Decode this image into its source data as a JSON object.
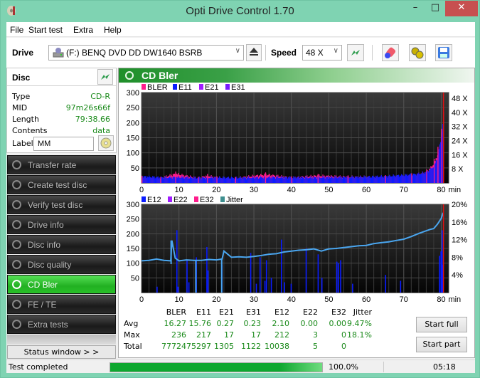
{
  "window": {
    "title": "Opti Drive Control 1.70",
    "min": "–",
    "max": "□",
    "close": "✕"
  },
  "menu": [
    "File",
    "Start test",
    "Extra",
    "Help"
  ],
  "toolbar": {
    "drive_label": "Drive",
    "drive_value": "(F:)   BENQ DVD DD DW1640 BSRB",
    "speed_label": "Speed",
    "speed_value": "48 X",
    "icons": [
      "eject-icon",
      "refresh-icon",
      "erase-icon",
      "settings-icon",
      "save-icon"
    ]
  },
  "disc": {
    "title": "Disc",
    "rows": [
      {
        "key": "Type",
        "value": "CD-R"
      },
      {
        "key": "MID",
        "value": "97m26s66f"
      },
      {
        "key": "Length",
        "value": "79:38.66"
      },
      {
        "key": "Contents",
        "value": "data"
      }
    ],
    "label_key": "Label",
    "label_value": "MM"
  },
  "nav": [
    {
      "label": "Transfer rate",
      "active": false
    },
    {
      "label": "Create test disc",
      "active": false
    },
    {
      "label": "Verify test disc",
      "active": false
    },
    {
      "label": "Drive info",
      "active": false
    },
    {
      "label": "Disc info",
      "active": false
    },
    {
      "label": "Disc quality",
      "active": false
    },
    {
      "label": "CD Bler",
      "active": true
    },
    {
      "label": "FE / TE",
      "active": false
    },
    {
      "label": "Extra tests",
      "active": false
    }
  ],
  "status_window_button": "Status window > >",
  "panel_title": "CD Bler",
  "chart_data": [
    {
      "type": "bar",
      "title": "BLER / E11 / E21 / E31",
      "legend": [
        {
          "name": "BLER",
          "color": "#ff1c8c"
        },
        {
          "name": "E11",
          "color": "#0a1cff"
        },
        {
          "name": "E21",
          "color": "#a01cff"
        },
        {
          "name": "E31",
          "color": "#7a1cff"
        }
      ],
      "xlabel": "min",
      "x_ticks": [
        0,
        10,
        20,
        30,
        40,
        50,
        60,
        70,
        80
      ],
      "xlim": [
        0,
        82
      ],
      "y_ticks": [
        50,
        100,
        150,
        200,
        250,
        300
      ],
      "ylim": [
        0,
        300
      ],
      "y2_ticks": [
        "8 X",
        "16 X",
        "24 X",
        "32 X",
        "40 X",
        "48 X"
      ],
      "series": [
        {
          "name": "E11",
          "x": [
            0,
            5,
            10,
            15,
            20,
            25,
            30,
            35,
            40,
            45,
            50,
            55,
            60,
            65,
            70,
            74,
            76,
            78,
            79,
            80,
            80.5
          ],
          "values": [
            22,
            18,
            19,
            17,
            18,
            17,
            18,
            19,
            18,
            18,
            19,
            19,
            20,
            22,
            26,
            30,
            36,
            55,
            90,
            160,
            215
          ]
        },
        {
          "name": "BLER",
          "x": [
            0,
            5,
            9,
            15,
            17.5,
            20,
            25,
            33,
            40,
            47,
            55,
            65,
            72,
            76,
            78,
            79,
            80,
            80.5
          ],
          "values": [
            24,
            20,
            38,
            20,
            30,
            22,
            20,
            35,
            22,
            30,
            25,
            26,
            32,
            45,
            80,
            120,
            180,
            236
          ]
        }
      ],
      "end_marker_x": 80.6
    },
    {
      "type": "bar",
      "title": "E12 / E22 / E32 / Jitter",
      "legend": [
        {
          "name": "E12",
          "color": "#0a1cff"
        },
        {
          "name": "E22",
          "color": "#a01cff"
        },
        {
          "name": "E32",
          "color": "#ff1c8c"
        },
        {
          "name": "Jitter",
          "color": "#3f8f8f"
        }
      ],
      "xlabel": "min",
      "x_ticks": [
        0,
        10,
        20,
        30,
        40,
        50,
        60,
        70,
        80
      ],
      "xlim": [
        0,
        82
      ],
      "y_ticks": [
        50,
        100,
        150,
        200,
        250,
        300
      ],
      "ylim": [
        0,
        300
      ],
      "y2_ticks": [
        "4%",
        "8%",
        "12%",
        "16%",
        "20%"
      ],
      "y2lim": [
        0,
        20
      ],
      "series": [
        {
          "name": "E12",
          "x": [
            4,
            9.3,
            9.6,
            12,
            12.5,
            14.5,
            17.3,
            17.6,
            21.3,
            29,
            30.5,
            31.5,
            32.8,
            33.2,
            34.5,
            37.2,
            38,
            39.8,
            43.8,
            47,
            48,
            52,
            52.4,
            53,
            56.2,
            65,
            69,
            79.4,
            79.8,
            80.1,
            80.3
          ],
          "values": [
            20,
            212,
            20,
            110,
            35,
            120,
            155,
            75,
            95,
            135,
            30,
            120,
            40,
            110,
            50,
            180,
            35,
            30,
            150,
            130,
            50,
            105,
            100,
            110,
            30,
            60,
            40,
            125,
            140,
            212,
            95
          ]
        },
        {
          "name": "Jitter",
          "x": [
            0,
            2,
            4,
            6,
            7.8,
            8.1,
            9,
            10,
            12,
            14,
            16,
            18,
            20,
            21.5,
            22,
            24,
            26,
            28,
            30,
            32,
            34,
            36,
            38,
            40,
            42,
            44,
            46,
            48,
            50,
            52,
            54,
            56,
            58,
            60,
            62,
            64,
            66,
            68,
            70,
            72,
            74,
            76,
            77,
            78,
            79,
            80,
            80.5
          ],
          "values": [
            7.2,
            7.3,
            7.6,
            7.3,
            7.2,
            11.8,
            7.8,
            7.2,
            7.4,
            7.3,
            7.3,
            7.5,
            7.4,
            7.6,
            9.4,
            8.0,
            8.1,
            8.0,
            8.2,
            8.4,
            8.7,
            8.8,
            9.2,
            9.4,
            9.6,
            9.7,
            9.9,
            9.4,
            9.9,
            10.0,
            10.2,
            10.4,
            10.6,
            10.7,
            11.1,
            11.3,
            11.5,
            11.8,
            12.1,
            12.7,
            13.4,
            14.0,
            14.3,
            14.5,
            15.5,
            16.8,
            18.1
          ]
        }
      ],
      "end_marker_x": 80.6
    }
  ],
  "stats": {
    "columns": [
      "BLER",
      "E11",
      "E21",
      "E31",
      "E12",
      "E22",
      "E32",
      "Jitter"
    ],
    "rows": [
      {
        "label": "Avg",
        "values": [
          "16.27",
          "15.76",
          "0.27",
          "0.23",
          "2.10",
          "0.00",
          "0.00",
          "9.47%"
        ]
      },
      {
        "label": "Max",
        "values": [
          "236",
          "217",
          "17",
          "17",
          "212",
          "3",
          "0",
          "18.1%"
        ]
      },
      {
        "label": "Total",
        "values": [
          "77724",
          "75297",
          "1305",
          "1122",
          "10038",
          "5",
          "0",
          ""
        ]
      }
    ]
  },
  "buttons": {
    "start_full": "Start full",
    "start_part": "Start part"
  },
  "statusbar": {
    "text": "Test completed",
    "progress": 100.0,
    "progress_text": "100.0%",
    "elapsed": "05:18"
  }
}
